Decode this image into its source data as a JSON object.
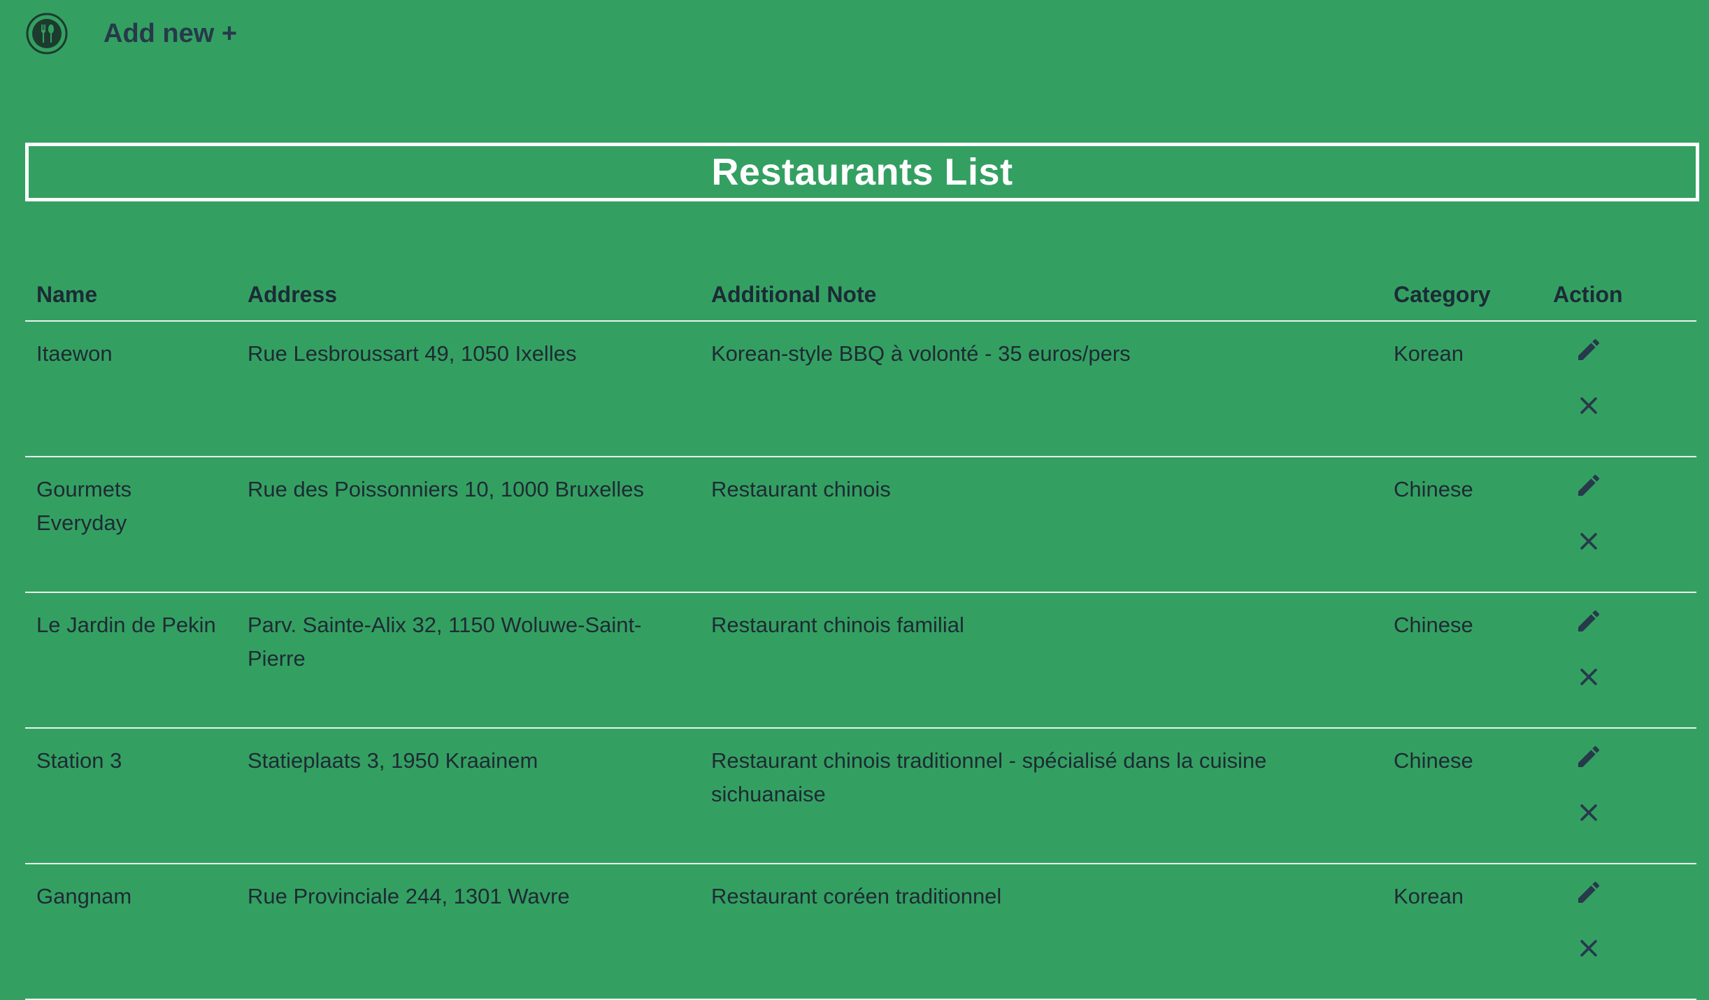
{
  "header": {
    "logo_icon": "fork-spoon-icon",
    "add_new_label": "Add new +"
  },
  "page": {
    "title": "Restaurants List"
  },
  "table": {
    "columns": [
      "Name",
      "Address",
      "Additional Note",
      "Category",
      "Action"
    ],
    "rows": [
      {
        "name": "Itaewon",
        "address": "Rue Lesbroussart 49, 1050 Ixelles",
        "note": "Korean-style BBQ à volonté - 35 euros/pers",
        "category": "Korean"
      },
      {
        "name": "Gourmets Everyday",
        "address": "Rue des Poissonniers 10, 1000 Bruxelles",
        "note": "Restaurant chinois",
        "category": "Chinese"
      },
      {
        "name": "Le Jardin de Pekin",
        "address": "Parv. Sainte-Alix 32, 1150 Woluwe-Saint-Pierre",
        "note": "Restaurant chinois familial",
        "category": "Chinese"
      },
      {
        "name": "Station 3",
        "address": "Statieplaats 3, 1950 Kraainem",
        "note": "Restaurant chinois traditionnel - spécialisé dans la cuisine sichuanaise",
        "category": "Chinese"
      },
      {
        "name": "Gangnam",
        "address": "Rue Provinciale 244, 1301 Wavre",
        "note": "Restaurant coréen traditionnel",
        "category": "Korean"
      }
    ],
    "action_icons": {
      "edit": "pencil-icon",
      "delete": "close-icon"
    }
  },
  "colors": {
    "background": "#33a062",
    "text": "#1f2a33",
    "title": "#ffffff",
    "divider": "#e8f5ec"
  }
}
